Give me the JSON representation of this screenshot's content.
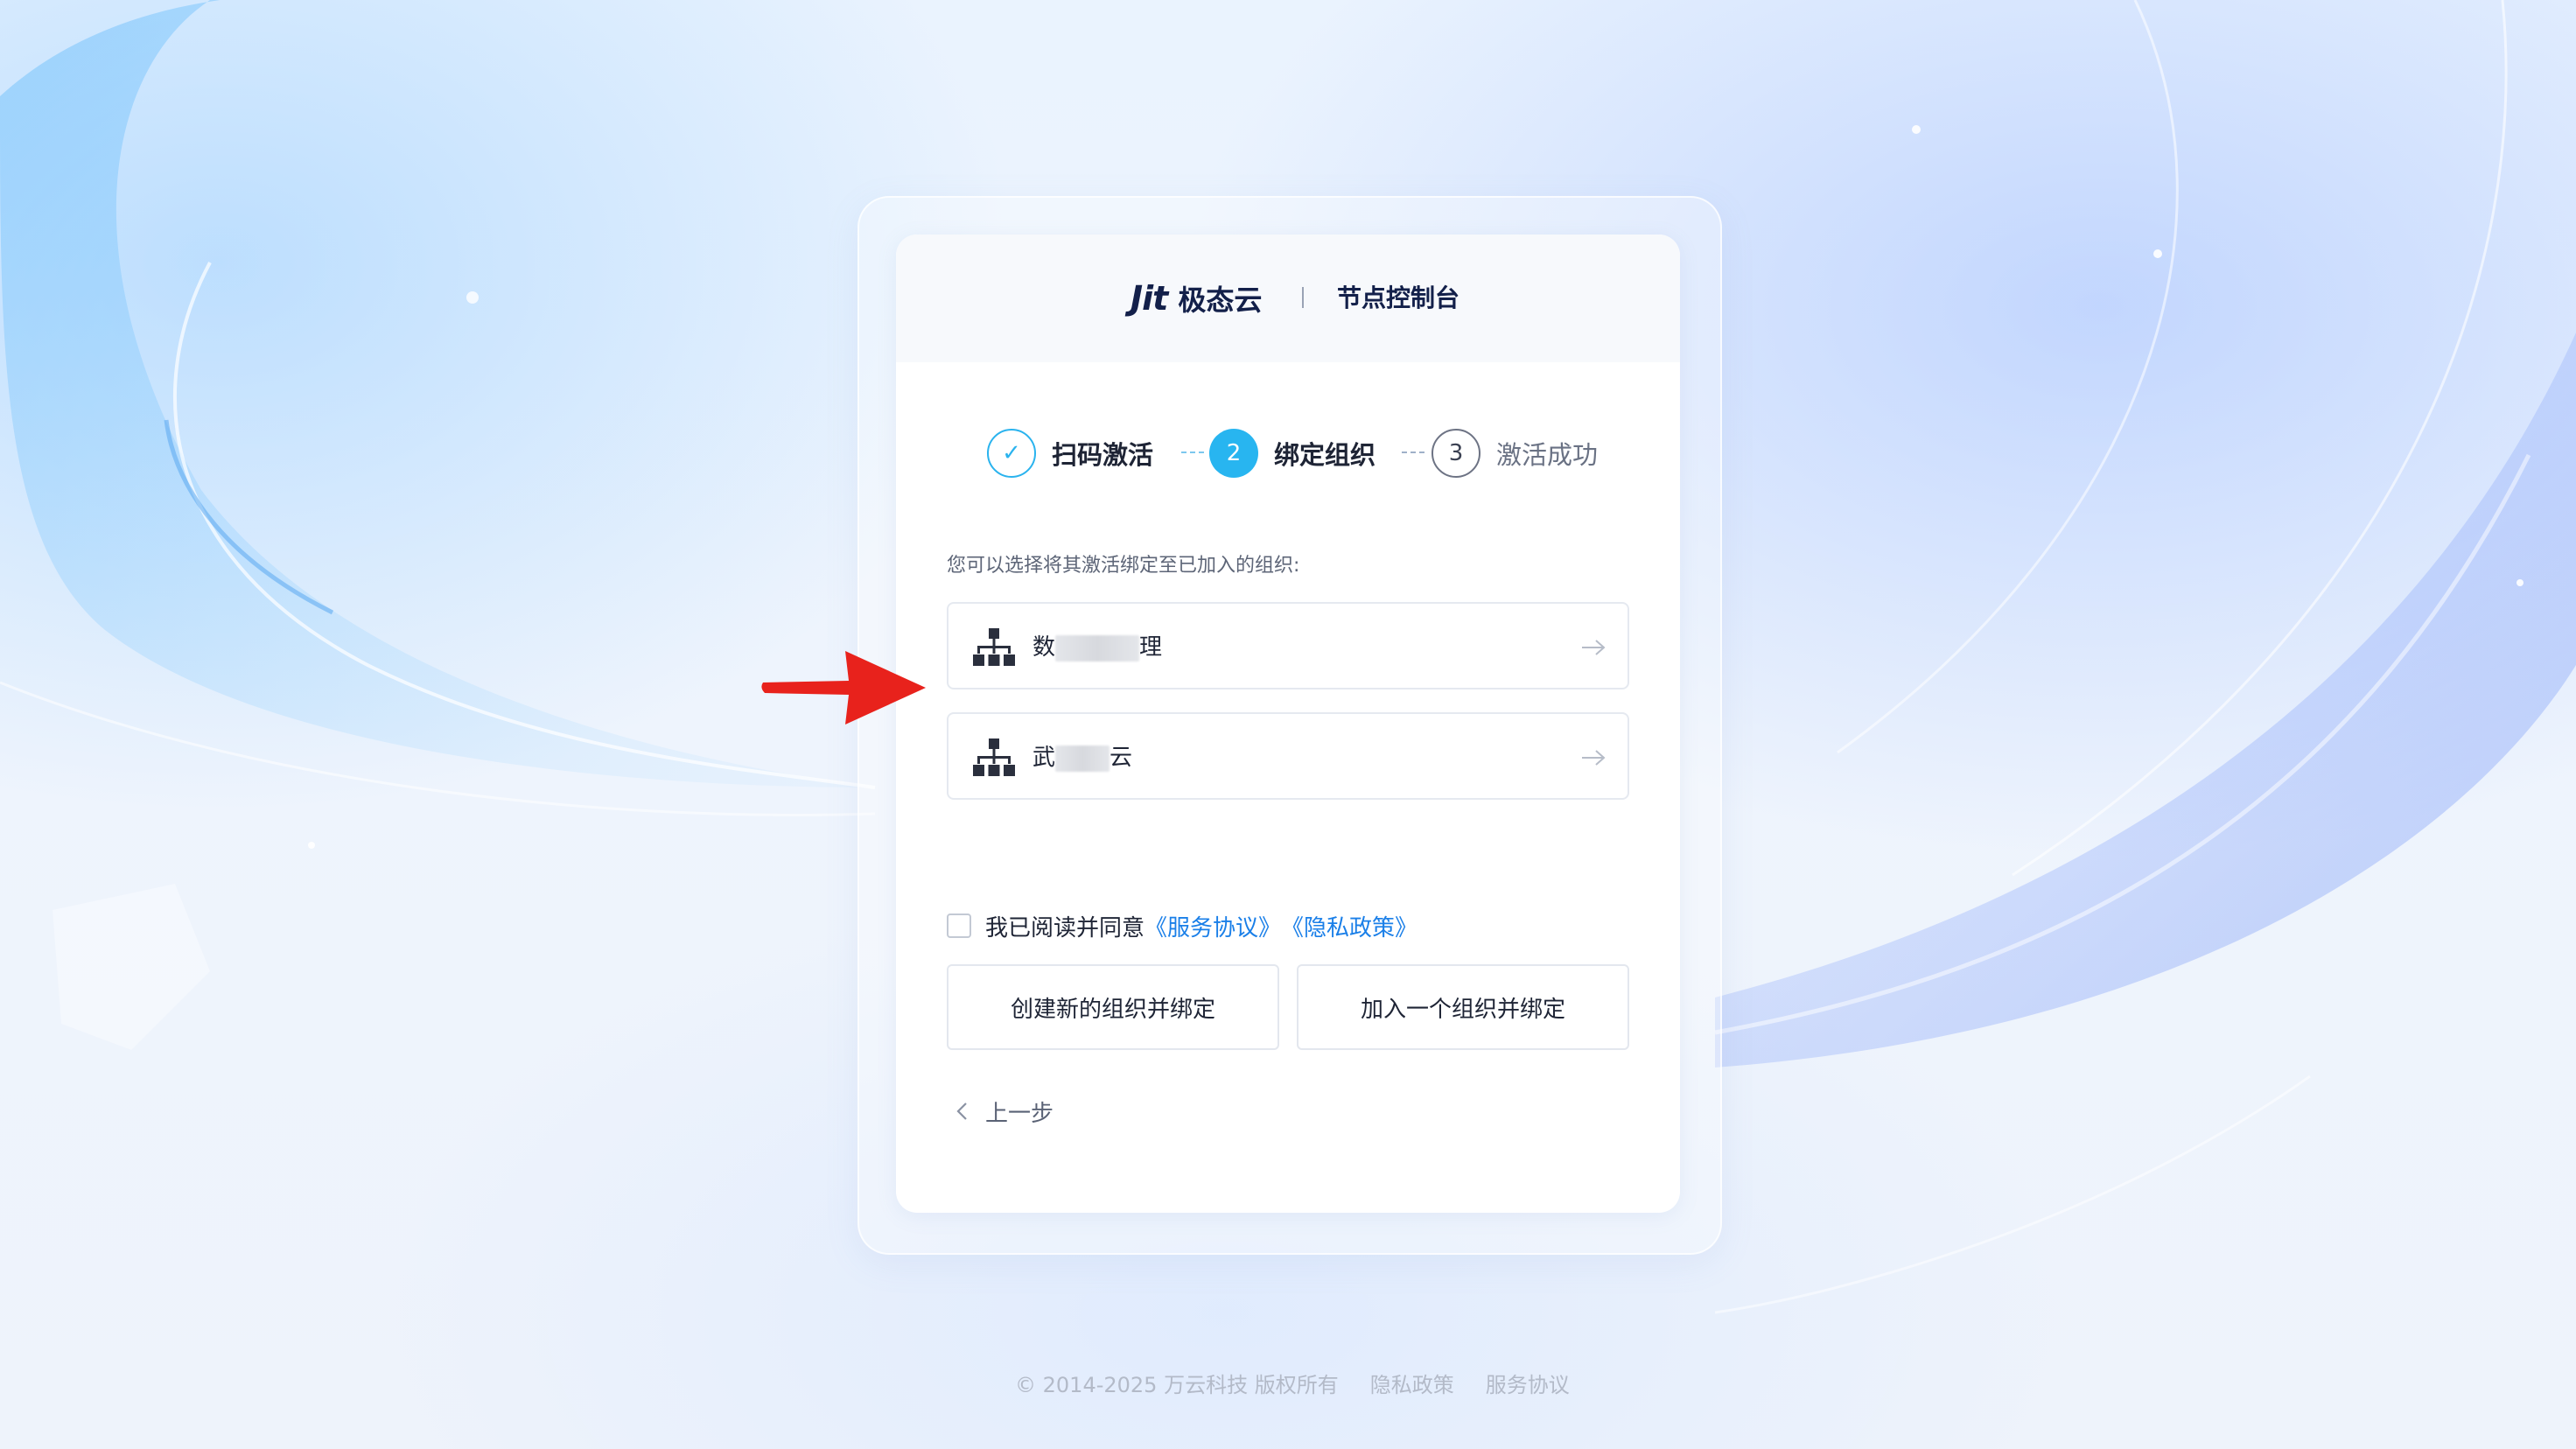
{
  "header": {
    "logo_mark": "Jit",
    "logo_name": "极态云",
    "title": "节点控制台"
  },
  "steps": [
    {
      "index": "✓",
      "label": "扫码激活",
      "state": "done"
    },
    {
      "index": "2",
      "label": "绑定组织",
      "state": "active"
    },
    {
      "index": "3",
      "label": "激活成功",
      "state": "todo"
    }
  ],
  "hint": "您可以选择将其激活绑定至已加入的组织:",
  "organizations": [
    {
      "name_start": "数",
      "name_end": "理"
    },
    {
      "name_start": "武",
      "name_end": "云"
    }
  ],
  "agreement": {
    "text": "我已阅读并同意",
    "terms_link": "《服务协议》",
    "privacy_link": "《隐私政策》"
  },
  "buttons": {
    "create": "创建新的组织并绑定",
    "join": "加入一个组织并绑定"
  },
  "back_label": "上一步",
  "footer": {
    "copyright": "© 2014-2025 万云科技 版权所有",
    "privacy": "隐私政策",
    "terms": "服务协议"
  },
  "colors": {
    "accent": "#28b5f0",
    "link": "#1a7fe8",
    "annotation_arrow": "#e8221c"
  }
}
